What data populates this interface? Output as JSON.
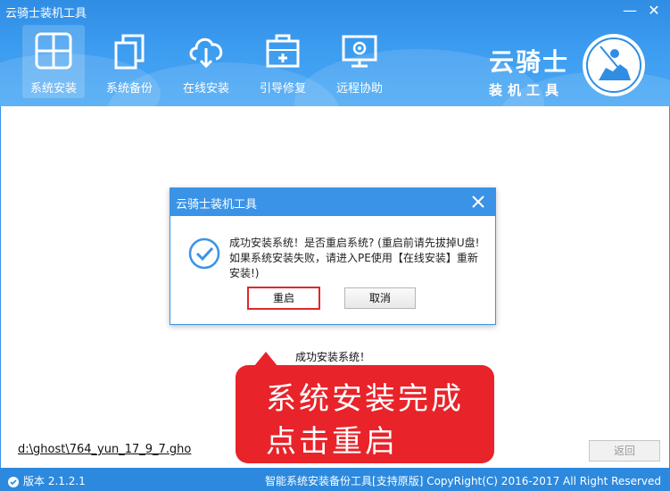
{
  "window": {
    "title": "云骑士装机工具",
    "minimize_glyph": "—",
    "close_glyph": "✕"
  },
  "nav": {
    "items": [
      {
        "label": "系统安装",
        "icon": "windows-icon",
        "active": true
      },
      {
        "label": "系统备份",
        "icon": "copy-icon",
        "active": false
      },
      {
        "label": "在线安装",
        "icon": "cloud-download-icon",
        "active": false
      },
      {
        "label": "引导修复",
        "icon": "medkit-icon",
        "active": false
      },
      {
        "label": "远程协助",
        "icon": "remote-monitor-icon",
        "active": false
      }
    ]
  },
  "brand": {
    "line1": "云骑士",
    "line2": "装机工具",
    "logo_icon": "knight-logo-icon"
  },
  "dialog": {
    "title": "云骑士装机工具",
    "message": "成功安装系统！是否重启系统? (重启前请先拔掉U盘! 如果系统安装失败，请进入PE使用【在线安装】重新安装!)",
    "confirm_label": "重启",
    "cancel_label": "取消"
  },
  "status": {
    "text": "成功安装系统！"
  },
  "callout": {
    "line1": "系统安装完成",
    "line2": "点击重启"
  },
  "footer_area": {
    "path": "d:\\ghost\\764_yun_17_9_7.gho",
    "back_label": "返回"
  },
  "footer": {
    "version": "版本 2.1.2.1",
    "copyright": "智能系统安装备份工具[支持原版]   CopyRight(C) 2016-2017 All Right Reserved"
  },
  "colors": {
    "header_blue": "#3a93e6",
    "accent_red": "#e8232a",
    "footer_blue": "#2d89dd"
  }
}
